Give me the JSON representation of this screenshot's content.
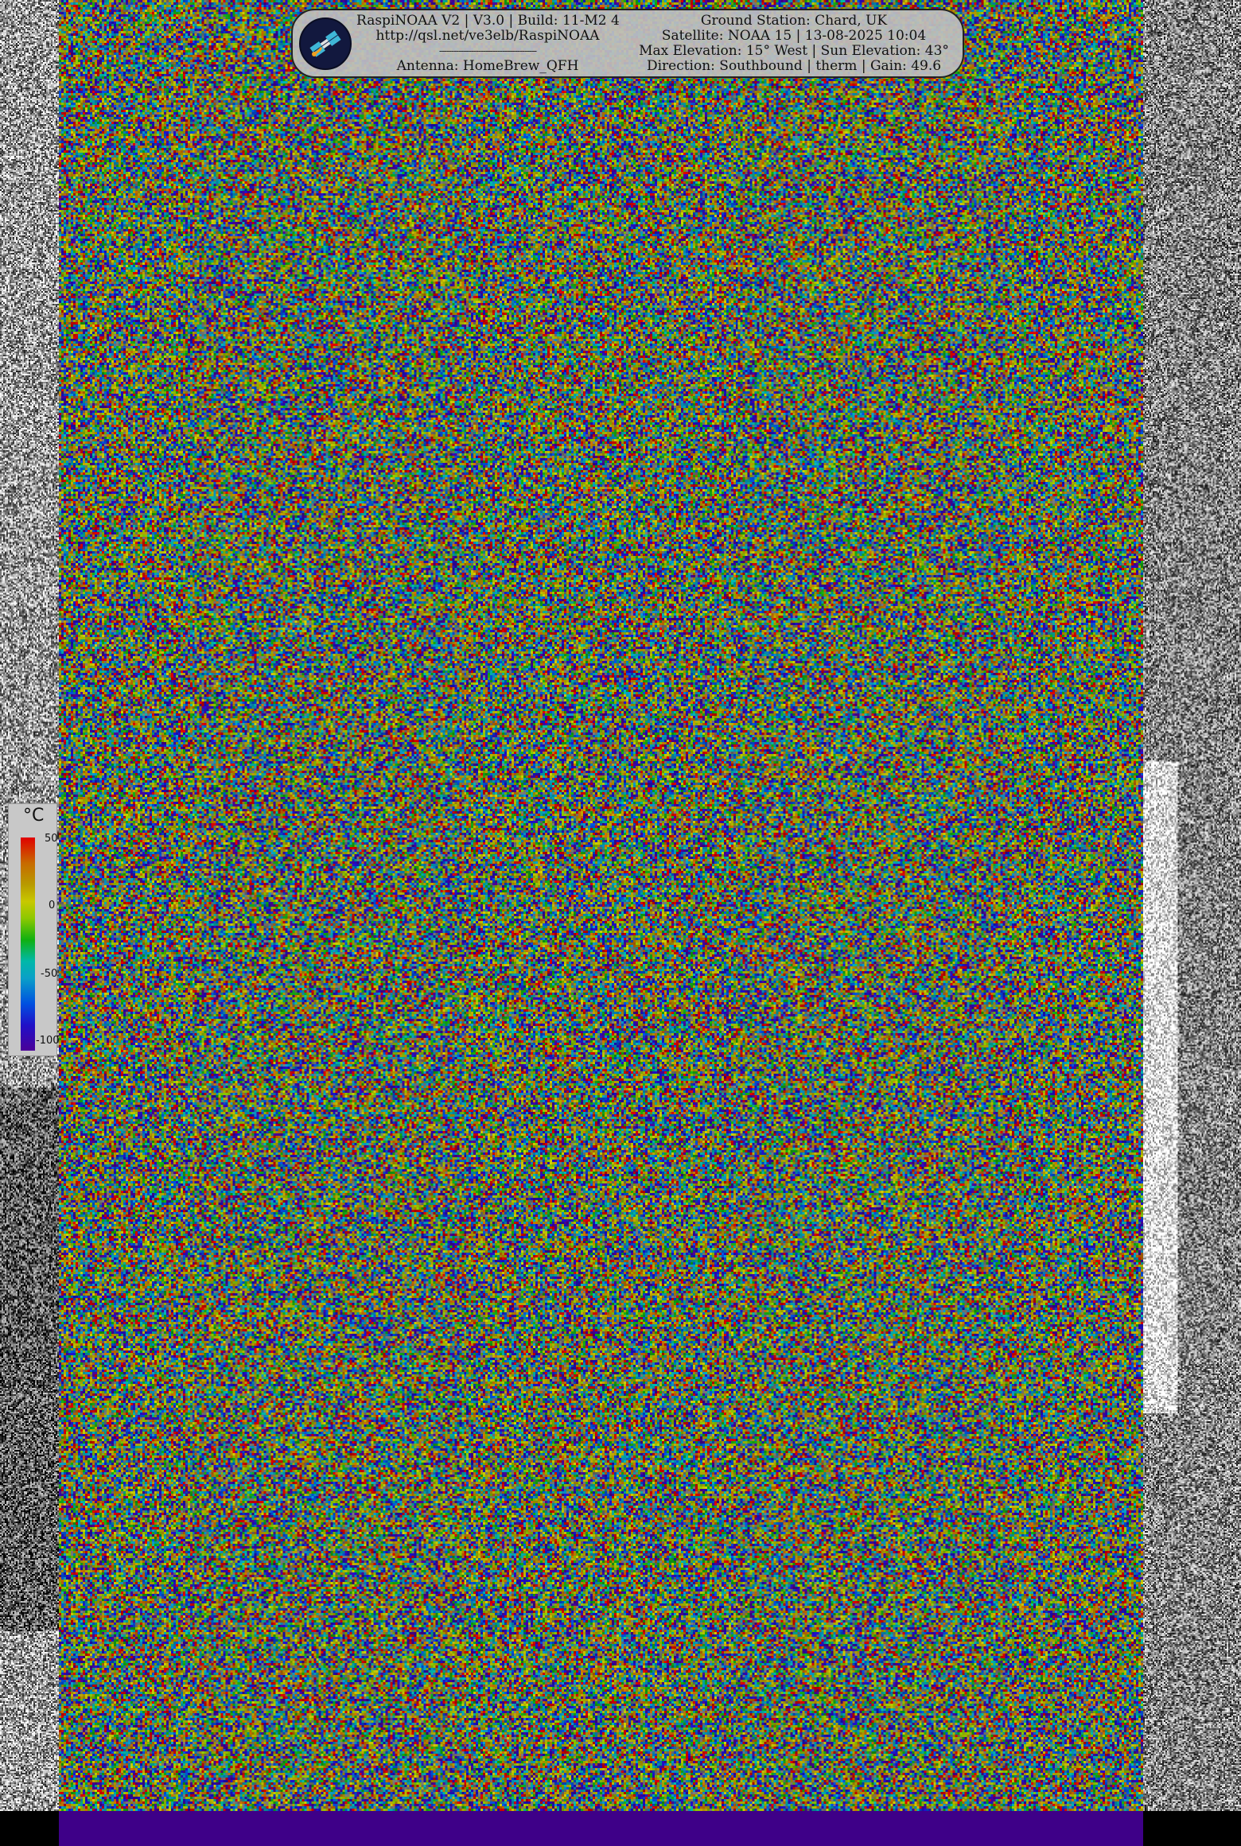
{
  "header": {
    "left": {
      "line1": "RaspiNOAA V2 | V3.0 | Build: 11-M2 4",
      "line2": "http://qsl.net/ve3elb/RaspiNOAA",
      "separator": "----------------------------------------",
      "line4": "Antenna: HomeBrew_QFH"
    },
    "right": {
      "line1": "Ground Station: Chard, UK",
      "line2": "Satellite: NOAA 15 | 13-08-2025 10:04",
      "line3": "Max Elevation: 15° West | Sun Elevation: 43°",
      "line4": "Direction: Southbound | therm | Gain: 49.6"
    }
  },
  "legend": {
    "unit": "°C",
    "ticks": [
      "50",
      "0",
      "-50",
      "-100"
    ]
  },
  "colors": {
    "bottom_bar": "#3e0088",
    "header_bg": "#bebebe"
  }
}
